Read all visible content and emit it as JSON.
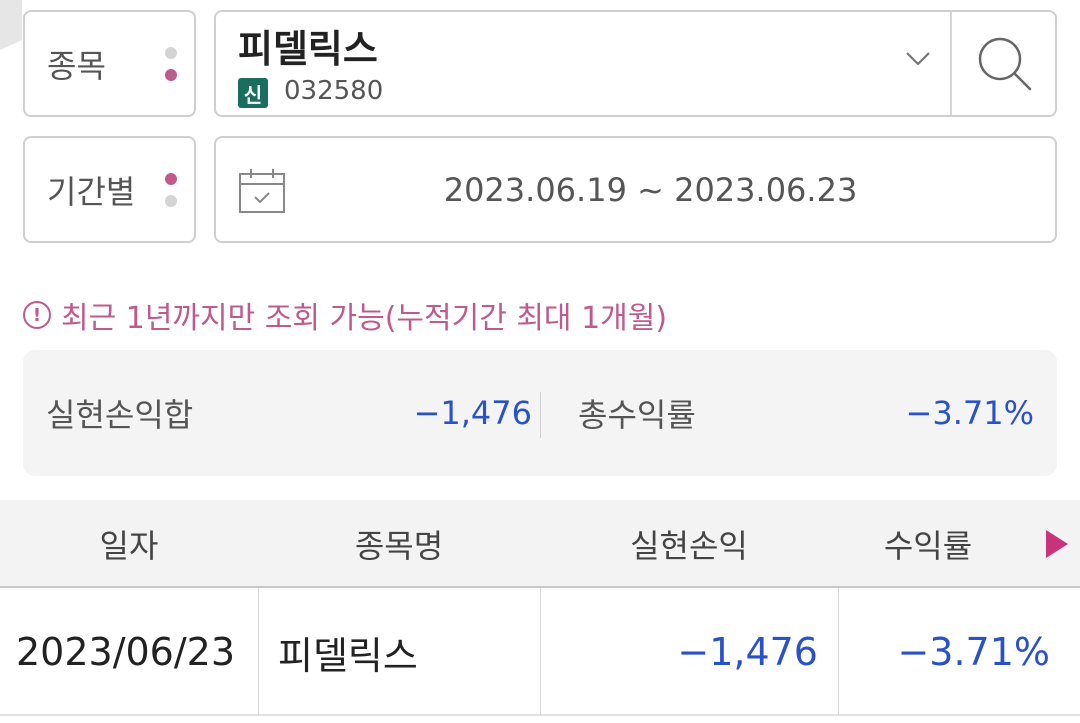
{
  "filters": {
    "stock_label": "종목",
    "period_label": "기간별"
  },
  "stock": {
    "name": "피델릭스",
    "badge": "신",
    "code": "032580"
  },
  "period": {
    "range": "2023.06.19 ~ 2023.06.23"
  },
  "notice": {
    "icon": "!",
    "text": "최근 1년까지만 조회 가능(누적기간 최대 1개월)"
  },
  "summary": {
    "realized_pnl_label": "실현손익합",
    "realized_pnl_value": "−1,476",
    "total_return_label": "총수익률",
    "total_return_value": "−3.71%"
  },
  "table": {
    "headers": [
      "일자",
      "종목명",
      "실현손익",
      "수익률"
    ],
    "rows": [
      [
        "2023/06/23",
        "피델릭스",
        "−1,476",
        "−3.71%"
      ]
    ]
  },
  "colors": {
    "accent": "#c05a8c",
    "negative": "#2a52c7",
    "badge": "#1a6e5e"
  }
}
